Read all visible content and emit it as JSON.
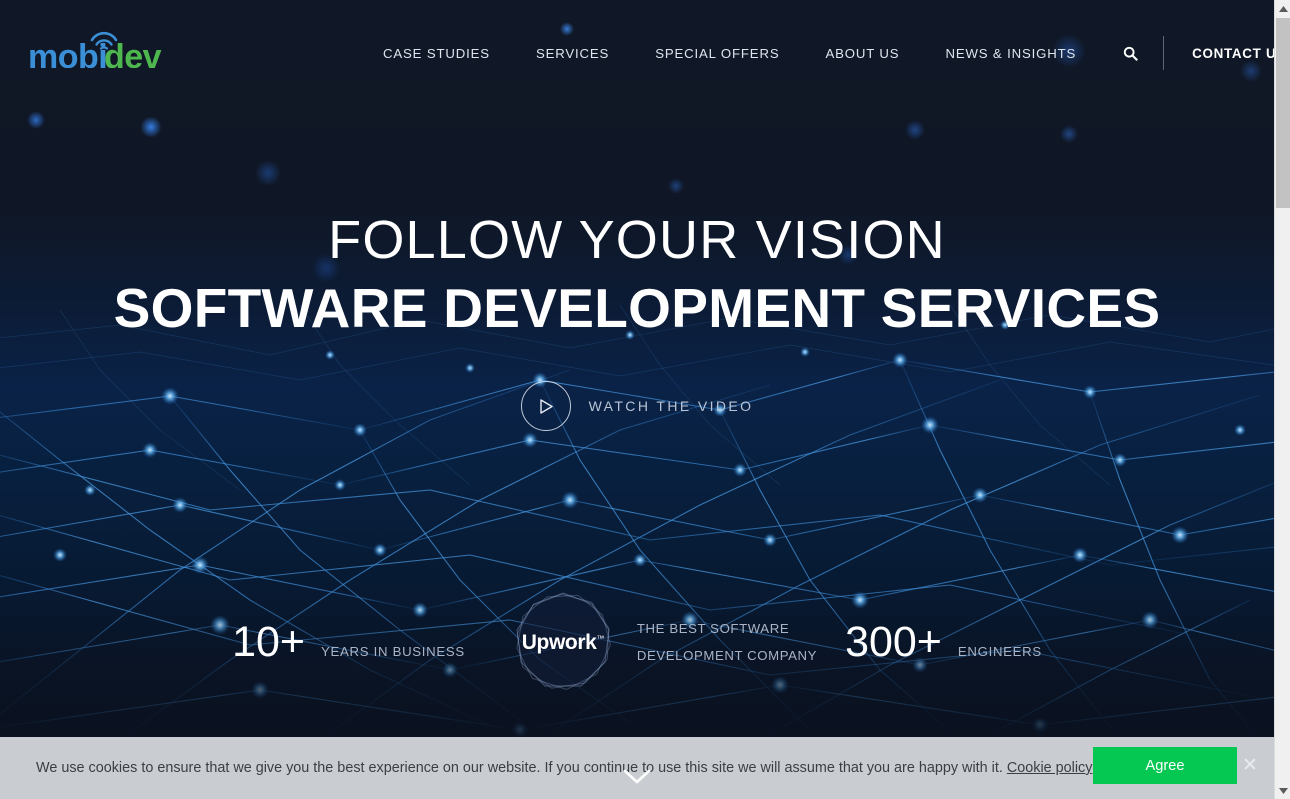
{
  "brand": {
    "logo_text_primary": "mobi",
    "logo_text_secondary": "dev",
    "color_primary": "#3b8fd6",
    "color_secondary": "#4eb74e"
  },
  "header": {
    "nav_items": [
      {
        "label": "CASE STUDIES"
      },
      {
        "label": "SERVICES"
      },
      {
        "label": "SPECIAL OFFERS"
      },
      {
        "label": "ABOUT US"
      },
      {
        "label": "NEWS & INSIGHTS"
      }
    ],
    "search_icon": "search-icon",
    "contact_label": "CONTACT US"
  },
  "hero": {
    "title_line1": "FOLLOW YOUR VISION",
    "title_line2": "SOFTWARE DEVELOPMENT SERVICES",
    "watch_label": "WATCH THE VIDEO",
    "play_icon": "play-icon"
  },
  "stats": {
    "years_value": "10+",
    "years_label": "YEARS IN BUSINESS",
    "badge_name": "Upwork",
    "badge_tm": "™",
    "badge_caption_line1": "THE BEST SOFTWARE",
    "badge_caption_line2": "DEVELOPMENT COMPANY",
    "engineers_value": "300+",
    "engineers_label": "ENGINEERS"
  },
  "scroll_indicator": {
    "icon": "chevron-down-icon"
  },
  "cookie": {
    "message": "We use cookies to ensure that we give you the best experience on our website. If you continue to use this site we will assume that you are happy with it.",
    "policy_link": "Cookie policy",
    "agree_label": "Agree",
    "close_icon": "close-icon",
    "accent_color": "#05c853",
    "bar_color": "#c9cdd2"
  },
  "scrollbar": {
    "up_arrow": "scroll-up-arrow",
    "down_arrow": "scroll-down-arrow"
  }
}
